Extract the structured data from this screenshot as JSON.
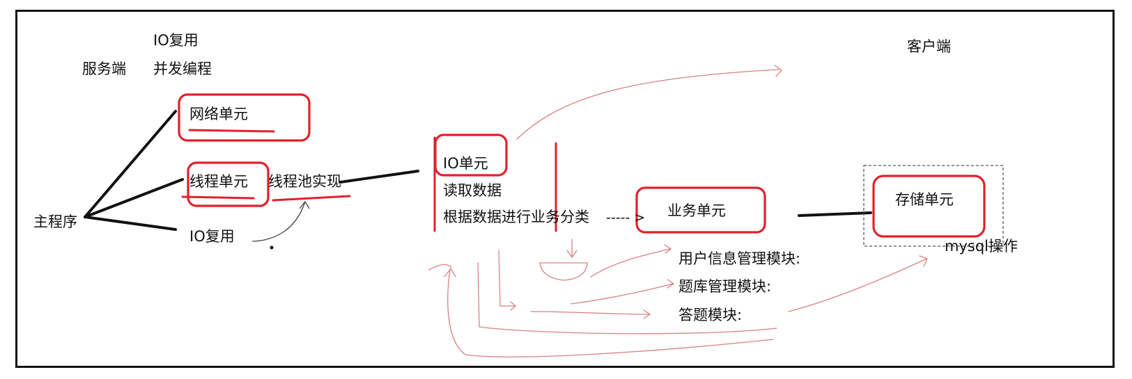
{
  "labels": {
    "io_mux_top": "IO复用",
    "server": "服务端",
    "concurrency": "并发编程",
    "client": "客户端",
    "network_unit": "网络单元",
    "thread_unit": "线程单元",
    "thread_pool": "线程池实现",
    "main_program": "主程序",
    "io_mux": "IO复用",
    "io_unit": "IO单元",
    "read_data": "读取数据",
    "classify": "根据数据进行业务分类",
    "arrow_tip": "----- >",
    "business_unit": "业务单元",
    "storage_unit": "存储单元",
    "mysql": "mysql操作",
    "user_module": "用户信息管理模块:",
    "question_module": "题库管理模块:",
    "answer_module": "答题模块:"
  },
  "colors": {
    "ink": "#111111",
    "red_pen": "#e0212b",
    "pink_pen": "#d98080",
    "dashed_box": "#555555"
  }
}
